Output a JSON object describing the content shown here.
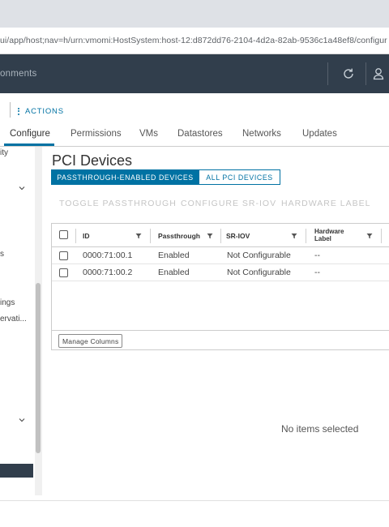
{
  "browser": {
    "url": "ui/app/host;nav=h/urn:vmomi:HostSystem:host-12:d872dd76-2104-4d2a-82ab-9536c1a48ef8/configur"
  },
  "header": {
    "title": "onments",
    "refresh_icon": "refresh-icon",
    "user_icon": "user-icon"
  },
  "actions": {
    "label": "ACTIONS"
  },
  "tabs": [
    {
      "label": "Configure",
      "active": true
    },
    {
      "label": "Permissions",
      "active": false
    },
    {
      "label": "VMs",
      "active": false
    },
    {
      "label": "Datastores",
      "active": false
    },
    {
      "label": "Networks",
      "active": false
    },
    {
      "label": "Updates",
      "active": false
    }
  ],
  "sidebar": {
    "items": [
      {
        "label": "ity"
      },
      {
        "label": "s"
      },
      {
        "label": "ings"
      },
      {
        "label": "ervati..."
      }
    ]
  },
  "main": {
    "title": "PCI Devices",
    "segments": {
      "selected": "PASSTHROUGH-ENABLED DEVICES",
      "other": "ALL PCI DEVICES"
    },
    "toolbar": {
      "toggle": "TOGGLE PASSTHROUGH",
      "configure": "CONFIGURE SR-IOV",
      "hardware": "HARDWARE LABEL"
    },
    "grid": {
      "columns": [
        "ID",
        "Passthrough",
        "SR-IOV",
        "Hardware Label"
      ],
      "rows": [
        [
          "0000:71:00.1",
          "Enabled",
          "Not Configurable",
          "--"
        ],
        [
          "0000:71:00.2",
          "Enabled",
          "Not Configurable",
          "--"
        ]
      ],
      "manage_columns": "Manage Columns"
    },
    "detail_empty": "No items selected"
  },
  "colors": {
    "accent": "#0072a3",
    "header_bg": "#313e4c"
  }
}
